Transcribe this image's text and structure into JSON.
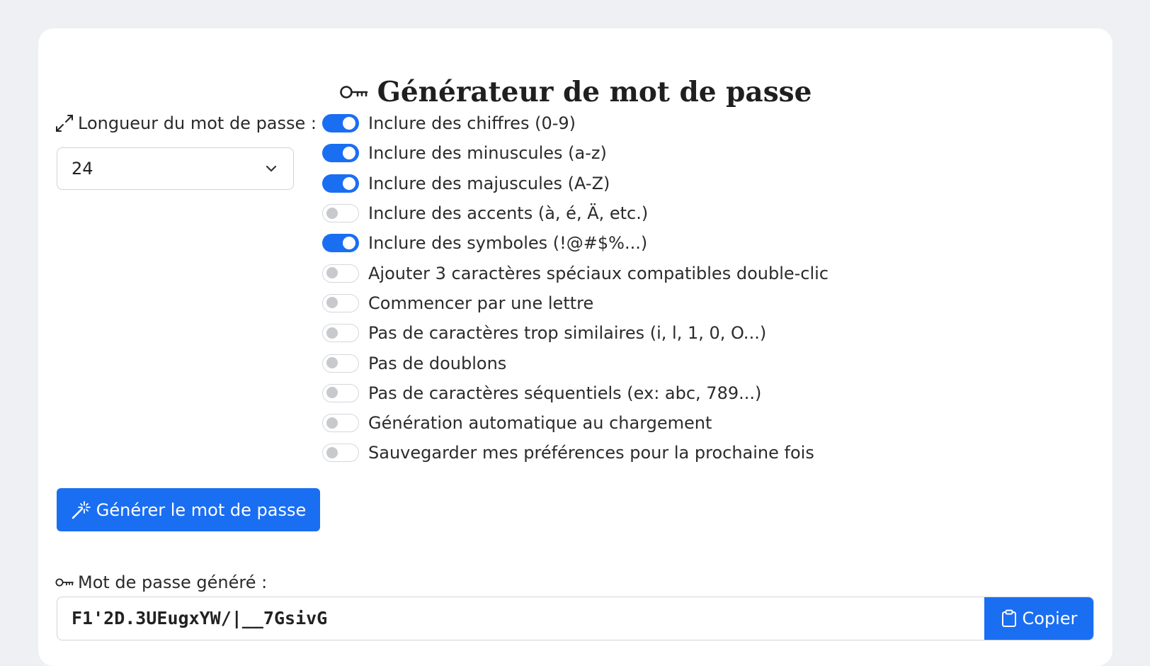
{
  "header": {
    "title": "Générateur de mot de passe",
    "icon": "key-icon"
  },
  "length": {
    "label": "Longueur du mot de passe :",
    "icon": "arrows-expand-icon",
    "value": "24"
  },
  "options": [
    {
      "label": "Inclure des chiffres (0-9)",
      "checked": true
    },
    {
      "label": "Inclure des minuscules (a-z)",
      "checked": true
    },
    {
      "label": "Inclure des majuscules (A-Z)",
      "checked": true
    },
    {
      "label": "Inclure des accents (à, é, Ä, etc.)",
      "checked": false
    },
    {
      "label": "Inclure des symboles (!@#$%...)",
      "checked": true
    },
    {
      "label": "Ajouter 3 caractères spéciaux compatibles double-clic",
      "checked": false
    },
    {
      "label": "Commencer par une lettre",
      "checked": false
    },
    {
      "label": "Pas de caractères trop similaires (i, l, 1, 0, O...)",
      "checked": false
    },
    {
      "label": "Pas de doublons",
      "checked": false
    },
    {
      "label": "Pas de caractères séquentiels (ex: abc, 789...)",
      "checked": false
    },
    {
      "label": "Génération automatique au chargement",
      "checked": false
    },
    {
      "label": "Sauvegarder mes préférences pour la prochaine fois",
      "checked": false
    }
  ],
  "generate": {
    "label": "Générer le mot de passe",
    "icon": "magic-wand-icon"
  },
  "output": {
    "label": "Mot de passe généré :",
    "icon": "key-icon",
    "value": "F1'2D.3UEugxYW/|__7GsivG",
    "copy_label": "Copier",
    "copy_icon": "clipboard-icon"
  },
  "colors": {
    "accent": "#1a6ef2",
    "background": "#eef0f3",
    "card": "#ffffff"
  }
}
